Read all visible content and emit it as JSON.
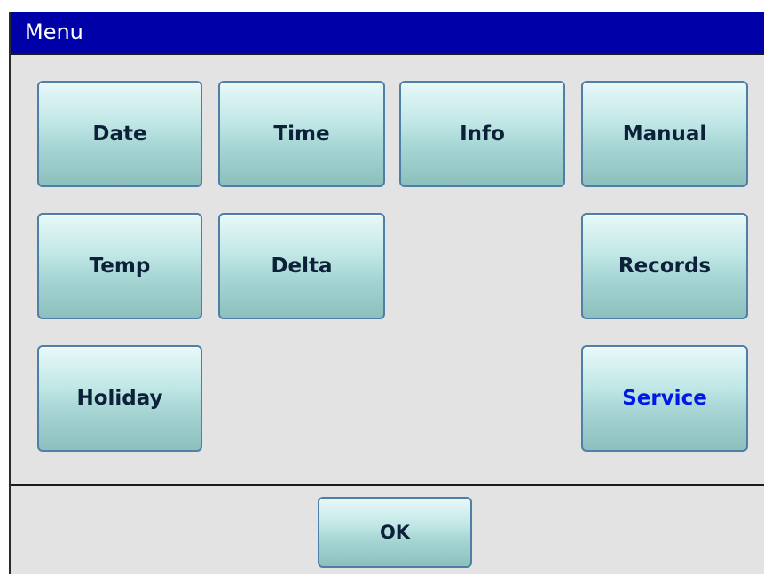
{
  "window": {
    "title": "Menu"
  },
  "menu": {
    "buttons": [
      {
        "id": "date",
        "label": "Date"
      },
      {
        "id": "time",
        "label": "Time"
      },
      {
        "id": "info",
        "label": "Info"
      },
      {
        "id": "manual",
        "label": "Manual"
      },
      {
        "id": "temp",
        "label": "Temp"
      },
      {
        "id": "delta",
        "label": "Delta"
      },
      {
        "id": "records",
        "label": "Records"
      },
      {
        "id": "holiday",
        "label": "Holiday"
      },
      {
        "id": "service",
        "label": "Service"
      }
    ]
  },
  "footer": {
    "ok_label": "OK"
  },
  "colors": {
    "titlebar": "#0000a8",
    "window_bg": "#e3e3e3",
    "button_top": "#e8f8f8",
    "button_bottom": "#8cc0bd",
    "button_border": "#4f7fa6",
    "button_text": "#0d2039",
    "service_text": "#0018e6"
  }
}
